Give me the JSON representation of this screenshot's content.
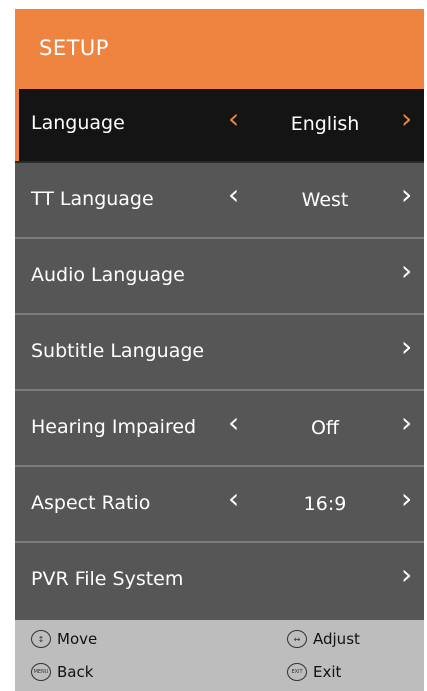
{
  "header": {
    "title": "SETUP"
  },
  "menu": [
    {
      "label": "Language",
      "value": "English",
      "has_left": true
    },
    {
      "label": "TT Language",
      "value": "West",
      "has_left": true
    },
    {
      "label": "Audio Language",
      "value": "",
      "has_left": false
    },
    {
      "label": "Subtitle Language",
      "value": "",
      "has_left": false
    },
    {
      "label": "Hearing Impaired",
      "value": "Off",
      "has_left": true
    },
    {
      "label": "Aspect Ratio",
      "value": "16:9",
      "has_left": true
    },
    {
      "label": "PVR File System",
      "value": "",
      "has_left": false
    }
  ],
  "footer": {
    "move": "Move",
    "adjust": "Adjust",
    "back": "Back",
    "exit": "Exit",
    "menu_key": "MENU",
    "exit_key": "EXIT"
  },
  "colors": {
    "accent": "#ee8440",
    "panel": "#565656",
    "active": "#141414",
    "footer": "#bdbdbd"
  },
  "icons": {
    "left": "chevron-left-icon",
    "right": "chevron-right-icon"
  }
}
